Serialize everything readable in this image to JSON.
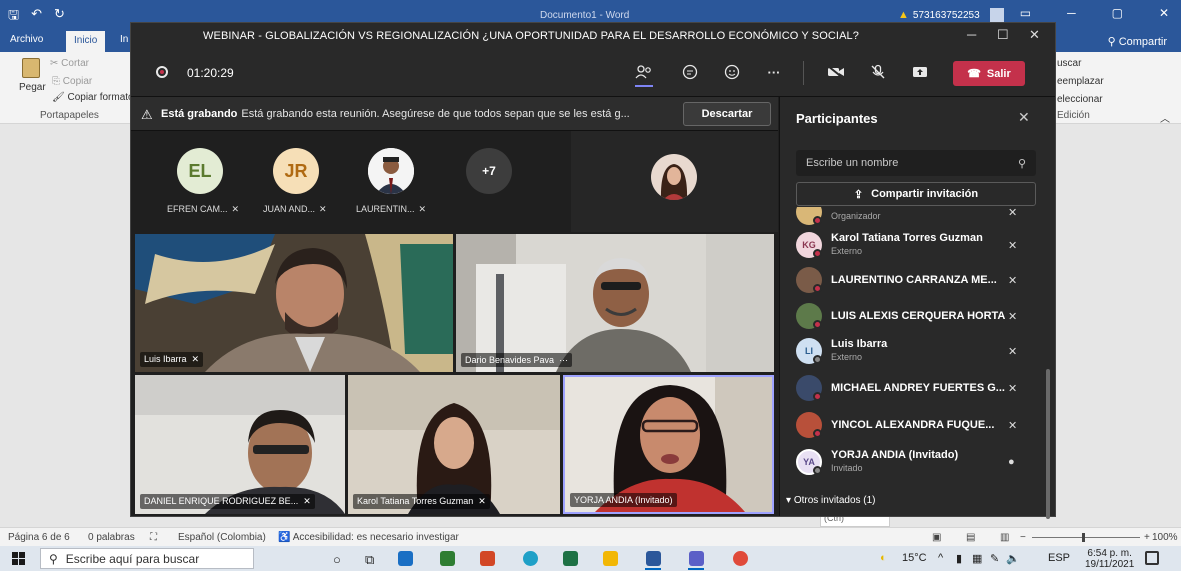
{
  "word": {
    "doc_title": "Documento1 - Word",
    "phone": "573163752253",
    "tabs": [
      "Archivo",
      "Inicio",
      "In"
    ],
    "share": "Compartir",
    "clipboard": {
      "paste": "Pegar",
      "cut": "Cortar",
      "copy": "Copiar",
      "format": "Copiar formato",
      "group": "Portapapeles"
    },
    "edit": {
      "find": "uscar",
      "replace": "eemplazar",
      "select": "eleccionar",
      "group": "Edición"
    },
    "status": {
      "page": "Página 6 de 6",
      "words": "0 palabras",
      "lang": "Español (Colombia)",
      "access": "Accesibilidad: es necesario investigar",
      "zoom": "100%"
    },
    "doc_tag": "(Ctrl)"
  },
  "teams": {
    "title": "WEBINAR - GLOBALIZACIÓN VS REGIONALIZACIÓN ¿UNA OPORTUNIDAD PARA EL DESARROLLO ECONÓMICO Y SOCIAL?",
    "timer": "01:20:29",
    "leave": "Salir",
    "recording_bold": "Está grabando",
    "recording_text": "Está grabando esta reunión. Asegúrese de que todos sepan que se les está g...",
    "dismiss": "Descartar",
    "avatars": [
      {
        "initials": "EL",
        "name": "EFREN CAM..."
      },
      {
        "initials": "JR",
        "name": "JUAN AND..."
      },
      {
        "initials": "",
        "name": "LAURENTIN..."
      },
      {
        "initials": "+7",
        "name": ""
      }
    ],
    "videos": [
      {
        "name": "Luis Ibarra"
      },
      {
        "name": "Dario Benavides Pava",
        "more": "···"
      },
      {
        "name": "DANIEL ENRIQUE RODRIGUEZ BE..."
      },
      {
        "name": "Karol Tatiana Torres Guzman"
      },
      {
        "name": "YORJA ANDIA (Invitado)"
      }
    ]
  },
  "panel": {
    "title": "Participantes",
    "search_placeholder": "Escribe un nombre",
    "invite": "Compartir invitación",
    "participants": [
      {
        "initials": "",
        "name": "",
        "sub": "Organizador"
      },
      {
        "initials": "KG",
        "name": "Karol Tatiana Torres Guzman",
        "sub": "Externo"
      },
      {
        "initials": "",
        "name": "LAURENTINO CARRANZA ME...",
        "sub": ""
      },
      {
        "initials": "",
        "name": "LUIS ALEXIS CERQUERA HORTA",
        "sub": ""
      },
      {
        "initials": "LI",
        "name": "Luis Ibarra",
        "sub": "Externo"
      },
      {
        "initials": "",
        "name": "MICHAEL ANDREY FUERTES G...",
        "sub": ""
      },
      {
        "initials": "",
        "name": "YINCOL ALEXANDRA FUQUE...",
        "sub": ""
      },
      {
        "initials": "YA",
        "name": "YORJA ANDIA (Invitado)",
        "sub": "Invitado"
      }
    ],
    "others": "Otros invitados (1)"
  },
  "taskbar": {
    "search": "Escribe aquí para buscar",
    "temp": "15°C",
    "lang": "ESP",
    "time": "6:54 p. m.",
    "date": "19/11/2021"
  }
}
